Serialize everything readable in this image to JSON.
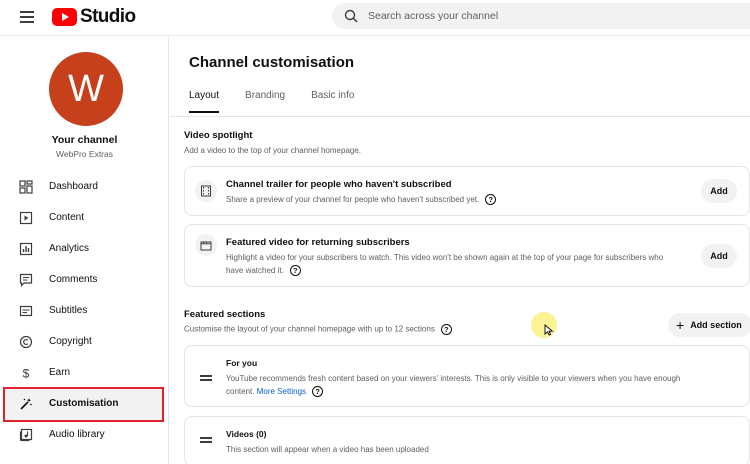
{
  "header": {
    "logo_text": "Studio",
    "search_placeholder": "Search across your channel"
  },
  "sidebar": {
    "avatar_letter": "W",
    "your_channel": "Your channel",
    "channel_name": "WebPro Extras",
    "items": [
      {
        "label": "Dashboard",
        "icon": "dashboard-icon"
      },
      {
        "label": "Content",
        "icon": "content-icon"
      },
      {
        "label": "Analytics",
        "icon": "analytics-icon"
      },
      {
        "label": "Comments",
        "icon": "comments-icon"
      },
      {
        "label": "Subtitles",
        "icon": "subtitles-icon"
      },
      {
        "label": "Copyright",
        "icon": "copyright-icon"
      },
      {
        "label": "Earn",
        "icon": "earn-icon"
      },
      {
        "label": "Customisation",
        "icon": "customisation-icon",
        "active": true
      },
      {
        "label": "Audio library",
        "icon": "audio-library-icon"
      }
    ],
    "highlight_color": "#e0222c"
  },
  "main": {
    "title": "Channel customisation",
    "tabs": [
      {
        "label": "Layout",
        "active": true
      },
      {
        "label": "Branding"
      },
      {
        "label": "Basic info"
      }
    ],
    "video_spotlight": {
      "heading": "Video spotlight",
      "subtitle": "Add a video to the top of your channel homepage.",
      "cards": [
        {
          "title": "Channel trailer for people who haven't subscribed",
          "description": "Share a preview of your channel for people who haven't subscribed yet.",
          "button": "Add"
        },
        {
          "title": "Featured video for returning subscribers",
          "description_line1": "Highlight a video for your subscribers to watch. This video won't be shown again at the top of your page for subscribers who",
          "description_line2": "have watched it.",
          "button": "Add"
        }
      ]
    },
    "featured_sections": {
      "heading": "Featured sections",
      "subtitle": "Customise the layout of your channel homepage with up to 12 sections",
      "add_button": "Add section",
      "sections": [
        {
          "title": "For you",
          "description_line1": "YouTube recommends fresh content based on your viewers' interests. This is only visible to your viewers when you have enough",
          "description_line2": "content.",
          "link": "More Settings"
        },
        {
          "title": "Videos (0)",
          "description": "This section will appear when a video has been uploaded"
        }
      ]
    }
  },
  "colors": {
    "brand_red": "#ff0000",
    "avatar": "#c7401c",
    "link": "#065fd4"
  }
}
